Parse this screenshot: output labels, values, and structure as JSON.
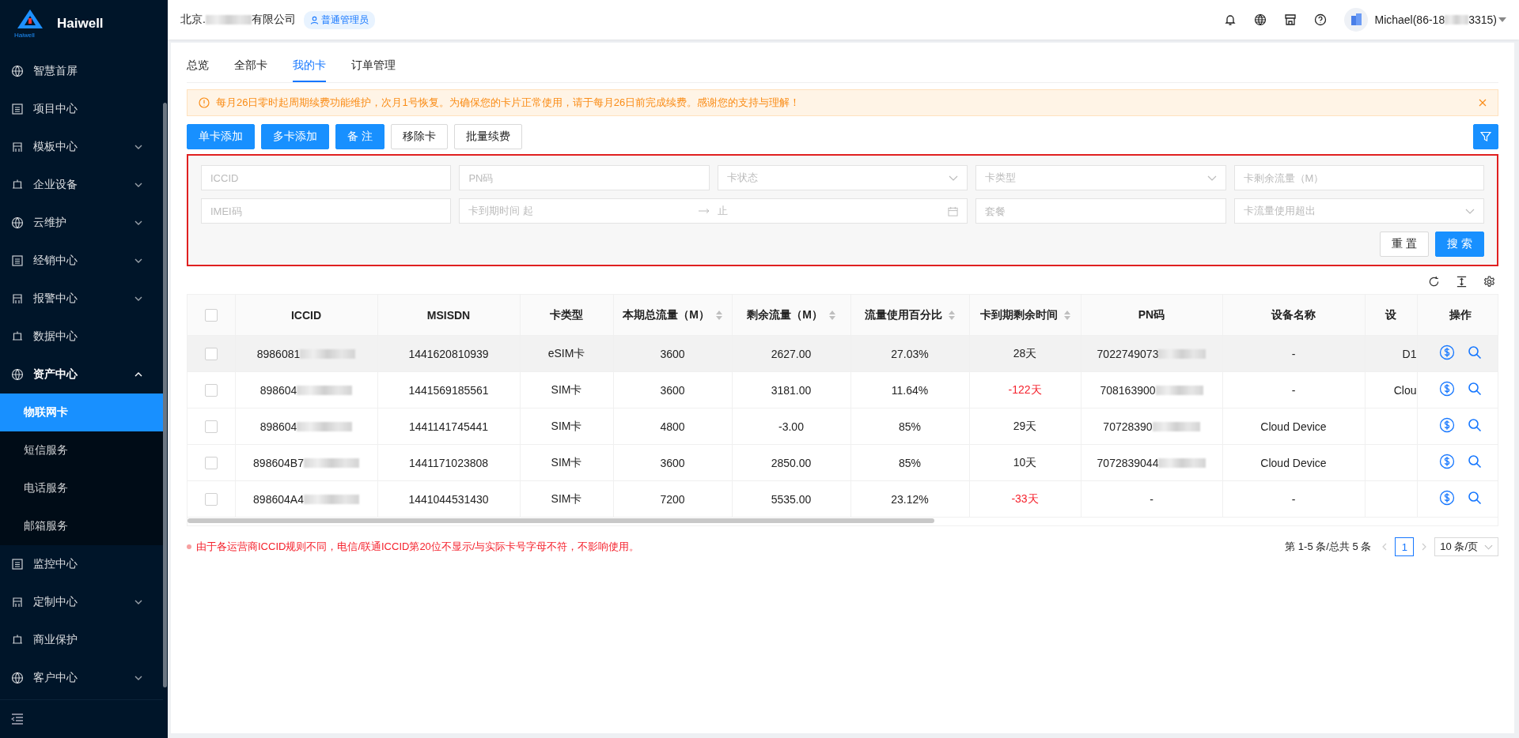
{
  "brand": {
    "name": "Haiwell",
    "logo_caption": "Haiwell"
  },
  "sidebar": {
    "items": [
      {
        "label": "智慧首屏",
        "selected": false
      },
      {
        "label": "项目中心",
        "selected": false
      },
      {
        "label": "模板中心",
        "selected": false,
        "expanded": false
      },
      {
        "label": "企业设备",
        "selected": false,
        "expanded": false
      },
      {
        "label": "云维护",
        "selected": false,
        "expanded": false
      },
      {
        "label": "经销中心",
        "selected": false,
        "expanded": false
      },
      {
        "label": "报警中心",
        "selected": false,
        "expanded": false
      },
      {
        "label": "数据中心",
        "selected": false
      },
      {
        "label": "资产中心",
        "selected": false,
        "expanded": true,
        "children": [
          {
            "label": "物联网卡",
            "selected": true
          },
          {
            "label": "短信服务",
            "selected": false
          },
          {
            "label": "电话服务",
            "selected": false
          },
          {
            "label": "邮箱服务",
            "selected": false
          }
        ]
      },
      {
        "label": "监控中心",
        "selected": false
      },
      {
        "label": "定制中心",
        "selected": false,
        "expanded": false
      },
      {
        "label": "商业保护",
        "selected": false
      },
      {
        "label": "客户中心",
        "selected": false,
        "expanded": false
      }
    ]
  },
  "header": {
    "company_prefix": "北京.",
    "company_suffix": "有限公司",
    "company_redacted": true,
    "role": "普通管理员",
    "user_prefix": "Michael(86-18",
    "user_suffix": "3315)",
    "user_redacted": true
  },
  "tabs": [
    {
      "label": "总览",
      "selected": false
    },
    {
      "label": "全部卡",
      "selected": false
    },
    {
      "label": "我的卡",
      "selected": true
    },
    {
      "label": "订单管理",
      "selected": false
    }
  ],
  "alert": {
    "text": "每月26日零时起周期续费功能维护，次月1号恢复。为确保您的卡片正常使用，请于每月26日前完成续费。感谢您的支持与理解！"
  },
  "actions": [
    {
      "label": "单卡添加",
      "kind": "primary"
    },
    {
      "label": "多卡添加",
      "kind": "primary"
    },
    {
      "label": "备 注",
      "kind": "primary"
    },
    {
      "label": "移除卡",
      "kind": "default"
    },
    {
      "label": "批量续费",
      "kind": "default"
    }
  ],
  "filters": [
    {
      "kind": "input",
      "placeholder": "ICCID"
    },
    {
      "kind": "input",
      "placeholder": "PN码"
    },
    {
      "kind": "select",
      "placeholder": "卡状态"
    },
    {
      "kind": "select",
      "placeholder": "卡类型"
    },
    {
      "kind": "input",
      "placeholder": "卡剩余流量（M）"
    },
    {
      "kind": "input",
      "placeholder": "IMEI码"
    },
    {
      "kind": "daterange",
      "placeholder": "卡到期时间 起",
      "placeholder_end": "止"
    },
    {
      "kind": "input",
      "placeholder": "套餐"
    },
    {
      "kind": "select",
      "placeholder": "卡流量使用超出"
    }
  ],
  "filter_buttons": [
    {
      "label": "重 置",
      "kind": "default"
    },
    {
      "label": "搜 索",
      "kind": "primary"
    }
  ],
  "table": {
    "header_checked": false,
    "columns": [
      {
        "label": "ICCID",
        "sortable": false
      },
      {
        "label": "MSISDN",
        "sortable": false
      },
      {
        "label": "卡类型",
        "sortable": false
      },
      {
        "label": "本期总流量（M）",
        "sortable": true
      },
      {
        "label": "剩余流量（M）",
        "sortable": true
      },
      {
        "label": "流量使用百分比",
        "sortable": true
      },
      {
        "label": "卡到期剩余时间",
        "sortable": true
      },
      {
        "label": "PN码",
        "sortable": false
      },
      {
        "label": "设备名称",
        "sortable": false
      },
      {
        "label": "设",
        "sortable": false
      },
      {
        "label": "操作",
        "sortable": false
      }
    ],
    "rows": [
      {
        "checked": false,
        "hovered": true,
        "iccid": "8986081",
        "iccid_redacted": true,
        "msisdn": "1441620810939",
        "type": "eSIM卡",
        "total": "3600",
        "remain": "2627.00",
        "percent": "27.03%",
        "days": "28天",
        "overdue": false,
        "pn": "7022749073",
        "pn_redacted": true,
        "device": "-",
        "column_10": "D1"
      },
      {
        "checked": false,
        "hovered": false,
        "iccid": "898604",
        "iccid_redacted": true,
        "msisdn": "1441569185561",
        "type": "SIM卡",
        "total": "3600",
        "remain": "3181.00",
        "percent": "11.64%",
        "days": "-122天",
        "overdue": true,
        "pn": "708163900",
        "pn_redacted": true,
        "device": "-",
        "column_10": "Clou"
      },
      {
        "checked": false,
        "hovered": false,
        "iccid": "898604",
        "iccid_redacted": true,
        "msisdn": "1441141745441",
        "type": "SIM卡",
        "total": "4800",
        "remain": "-3.00",
        "percent": "85%",
        "days": "29天",
        "overdue": false,
        "pn": "70728390",
        "pn_redacted": true,
        "device": "Cloud Device"
      },
      {
        "checked": false,
        "hovered": false,
        "iccid": "898604B7",
        "iccid_redacted": true,
        "msisdn": "1441171023808",
        "type": "SIM卡",
        "total": "3600",
        "remain": "2850.00",
        "percent": "85%",
        "days": "10天",
        "overdue": false,
        "pn": "7072839044",
        "pn_redacted": true,
        "device": "Cloud Device"
      },
      {
        "checked": false,
        "hovered": false,
        "iccid": "898604A4",
        "iccid_redacted": true,
        "msisdn": "1441044531430",
        "type": "SIM卡",
        "total": "7200",
        "remain": "5535.00",
        "percent": "23.12%",
        "days": "-33天",
        "overdue": true,
        "pn": "-",
        "pn_redacted": false,
        "device": "-"
      }
    ]
  },
  "footnote": "由于各运营商ICCID规则不同，电信/联通ICCID第20位不显示/与实际卡号字母不符，不影响使用。",
  "pagination": {
    "summary": "第 1-5 条/总共 5 条",
    "pages": [
      {
        "label": "1",
        "selected": true
      }
    ],
    "page_size": "10 条/页"
  }
}
